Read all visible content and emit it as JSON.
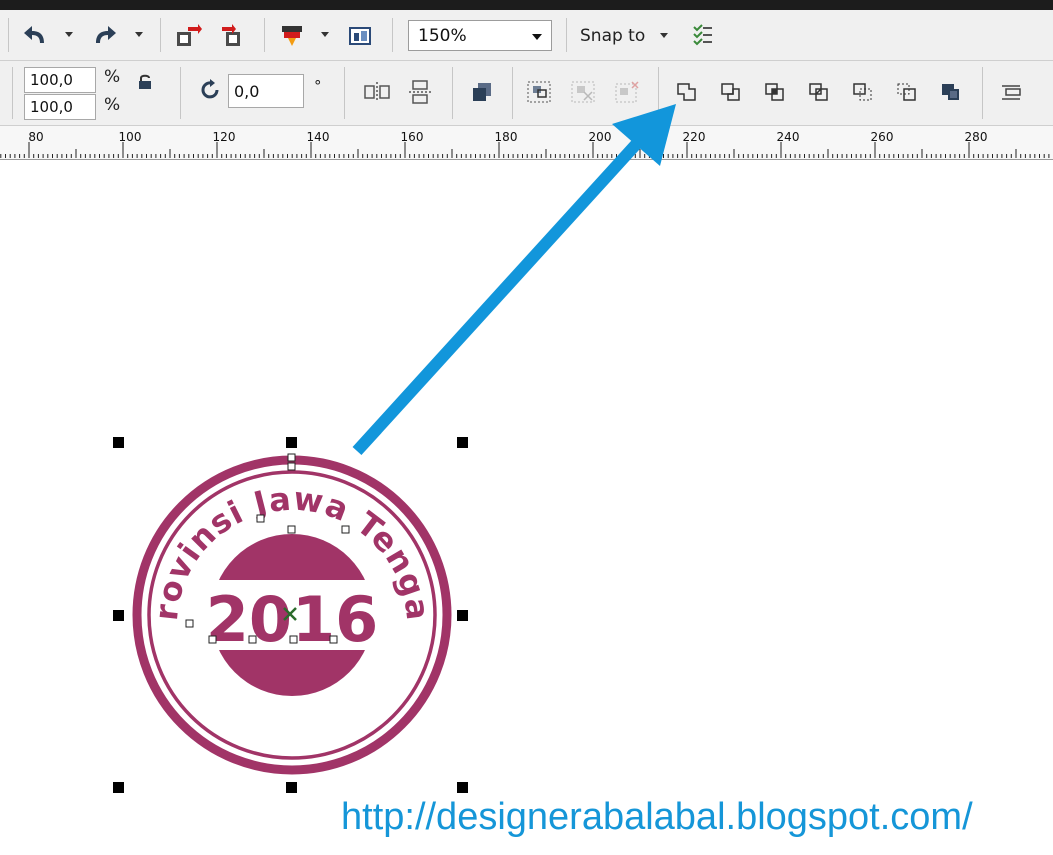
{
  "toolbar": {
    "zoom_value": "150%",
    "snap_label": "Snap to"
  },
  "property_bar": {
    "scale_width": "100,0",
    "scale_height": "100,0",
    "percent_symbol": "%",
    "rotation_value": "0,0",
    "degree_symbol": "°"
  },
  "ruler": {
    "labels": [
      "80",
      "100",
      "120",
      "140",
      "160",
      "180",
      "200",
      "220",
      "240",
      "260",
      "280"
    ]
  },
  "canvas": {
    "stamp_arc_text": "Provinsi Jawa Tengah",
    "stamp_year": "2016",
    "watermark_url": "http://designerabalabal.blogspot.com/"
  },
  "colors": {
    "stamp": "#a13467",
    "arrow": "#1296db",
    "url": "#1596d8"
  }
}
